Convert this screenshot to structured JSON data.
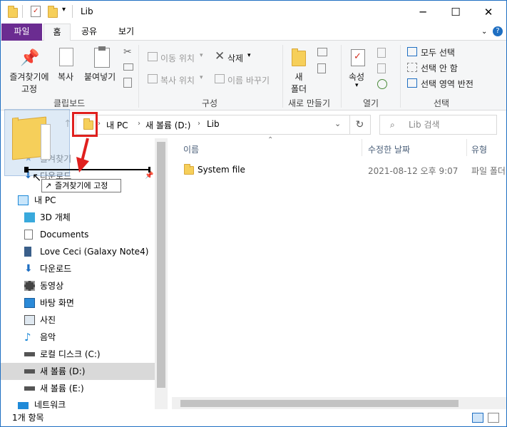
{
  "window": {
    "title": "Lib",
    "minimize": "─",
    "maximize": "☐",
    "close": "✕"
  },
  "tabs": [
    {
      "label": "파일"
    },
    {
      "label": "홈"
    },
    {
      "label": "공유"
    },
    {
      "label": "보기"
    }
  ],
  "ribbon": {
    "clipboard": {
      "group": "클립보드",
      "pin_line1": "즐겨찾기에",
      "pin_line2": "고정",
      "copy": "복사",
      "paste": "붙여넣기"
    },
    "organize": {
      "group": "구성",
      "move_to": "이동 위치",
      "copy_to": "복사 위치",
      "delete": "삭제",
      "rename": "이름 바꾸기"
    },
    "new": {
      "group": "새로 만들기",
      "folder_line1": "새",
      "folder_line2": "폴더"
    },
    "open": {
      "group": "열기",
      "properties": "속성"
    },
    "select": {
      "group": "선택",
      "select_all": "모두 선택",
      "select_none": "선택 안 함",
      "invert": "선택 영역 반전"
    }
  },
  "address": {
    "path": [
      "내 PC",
      "새 볼륨 (D:)",
      "Lib"
    ],
    "search_placeholder": "Lib 검색"
  },
  "nav": {
    "quick_access": "즐겨찾기",
    "downloads_pinned": "다운로드",
    "tooltip": "즐겨찾기에 고정",
    "items": [
      {
        "label": "내 PC",
        "icon": "pc-icon"
      },
      {
        "label": "3D 개체",
        "icon": "cube-icon"
      },
      {
        "label": "Documents",
        "icon": "document-icon"
      },
      {
        "label": "Love Ceci (Galaxy Note4)",
        "icon": "phone-icon"
      },
      {
        "label": "다운로드",
        "icon": "download-icon"
      },
      {
        "label": "동영상",
        "icon": "video-icon"
      },
      {
        "label": "바탕 화면",
        "icon": "desktop-icon"
      },
      {
        "label": "사진",
        "icon": "picture-icon"
      },
      {
        "label": "음악",
        "icon": "music-icon"
      },
      {
        "label": "로컬 디스크 (C:)",
        "icon": "drive-icon"
      },
      {
        "label": "새 볼륨 (D:)",
        "icon": "drive-icon"
      },
      {
        "label": "새 볼륨 (E:)",
        "icon": "drive-icon"
      },
      {
        "label": "네트워크",
        "icon": "network-icon"
      }
    ]
  },
  "columns": {
    "name": "이름",
    "modified": "수정한 날짜",
    "type": "유형"
  },
  "files": [
    {
      "name": "System file",
      "modified": "2021-08-12 오후 9:07",
      "type": "파일 폴더"
    }
  ],
  "status": {
    "count": "1개 항목"
  },
  "colors": {
    "file_tab": "#6b2c91",
    "highlight": "#e0201e",
    "folder": "#f6cf5a",
    "selected_nav": "#d9d9d9"
  }
}
